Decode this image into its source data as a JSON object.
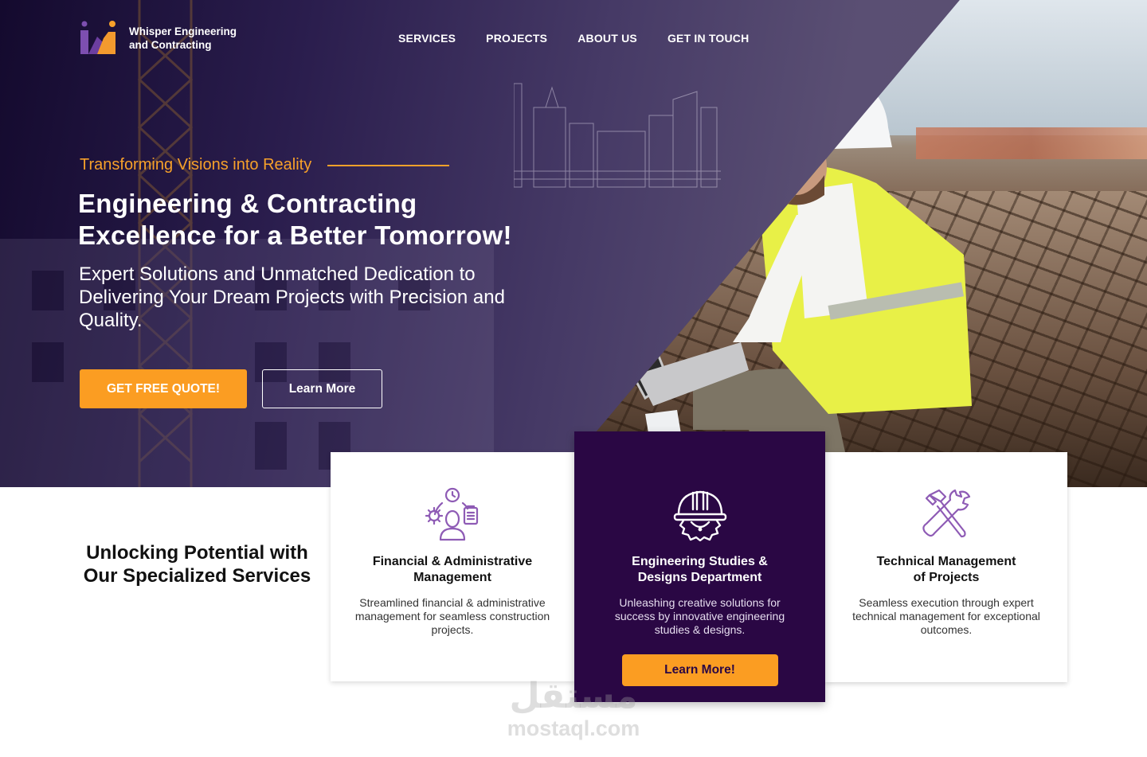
{
  "brand": {
    "name_line1": "Whisper Engineering",
    "name_line2": "and Contracting",
    "colors": {
      "primary": "#2a0744",
      "accent": "#fb9d22",
      "icon_purple": "#8e5bb5"
    }
  },
  "nav": {
    "items": [
      {
        "label": "SERVICES"
      },
      {
        "label": "PROJECTS"
      },
      {
        "label": "ABOUT US"
      },
      {
        "label": "GET IN TOUCH"
      }
    ]
  },
  "hero": {
    "tagline": "Transforming Visions into Reality",
    "headline_line1": "Engineering & Contracting",
    "headline_line2": "Excellence for a Better Tomorrow!",
    "subheadline": "Expert Solutions and Unmatched Dedication to Delivering Your Dream Projects with Precision and Quality.",
    "primary_button": "GET FREE QUOTE!",
    "secondary_button": "Learn More"
  },
  "services": {
    "title": "Unlocking Potential with Our Specialized Services",
    "cards": [
      {
        "icon": "management-person-icon",
        "title_line1": "Financial & Administrative",
        "title_line2": "Management",
        "description": "Streamlined financial & administrative management for seamless construction projects."
      },
      {
        "icon": "helmet-gear-icon",
        "title_line1": "Engineering Studies &",
        "title_line2": "Designs Department",
        "description": "Unleashing creative solutions for success by innovative engineering studies & designs.",
        "button": "Learn More!"
      },
      {
        "icon": "hammer-wrench-icon",
        "title_line1": "Technical Management",
        "title_line2": "of Projects",
        "description": "Seamless execution through expert technical management for exceptional outcomes."
      }
    ]
  },
  "watermark": {
    "arabic": "مستقل",
    "latin": "mostaql.com"
  }
}
